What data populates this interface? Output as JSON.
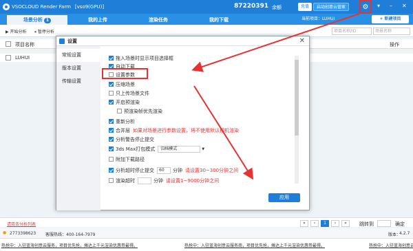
{
  "app": {
    "title": "VSOCLOUD Render Farm",
    "machine": "[vso9(GPU)]",
    "credits": "87220391",
    "balance": "余额",
    "recharge": "充值",
    "open_manager": "启动创意云管家",
    "gear_icon": "gear-icon",
    "minimize": "–",
    "close": "✕"
  },
  "nav": {
    "tabs": [
      {
        "label": "场景分析",
        "badge": "1"
      },
      {
        "label": "我的上传"
      },
      {
        "label": "渲染任务"
      },
      {
        "label": "我的下载"
      }
    ],
    "current_project_label": "当前项目：",
    "current_project": "LUHUI",
    "new_project": "+ 新建项目"
  },
  "toolbar": {
    "start": "▶ 开始分析",
    "pause": "⏸ 暂停分析",
    "project_search_placeholder": "项目名称/ID",
    "scene_search_placeholder": "场景名称"
  },
  "list": {
    "header_project": "项目名称",
    "header_ops": "操作",
    "rows": [
      "LUHUI"
    ]
  },
  "dialog": {
    "title": "设置",
    "close": "✕",
    "nav": [
      "常规设置",
      "版本设置",
      "传输设置"
    ],
    "options": [
      {
        "label": "拖入场景时显示项目选择框",
        "checked": true
      },
      {
        "label": "自动下载",
        "checked": true
      },
      {
        "label": "设置参数",
        "checked": false
      },
      {
        "label": "压缩场景",
        "checked": true
      },
      {
        "label": "只上传场景文件",
        "checked": false
      },
      {
        "label": "开启预渲染",
        "checked": true
      },
      {
        "label": "预渲染帧优先渲染",
        "checked": false
      },
      {
        "label": "重新分析",
        "checked": true
      },
      {
        "label": "合并层",
        "checked": true,
        "hint": "如果对场景进行参数设置，将不使用默认相机渲染"
      },
      {
        "label": "分析警告停止提交",
        "checked": true
      },
      {
        "label": "3ds Max打包模式",
        "checked": true,
        "select": "归档模式"
      },
      {
        "label": "附加下载路径",
        "checked": false
      },
      {
        "label": "分析超时停止提交",
        "checked": true,
        "value": "60",
        "unit": "分钟",
        "hint": "请设置30~300分钟之间"
      },
      {
        "label": "渲染超时",
        "checked": false,
        "unit": "分钟",
        "hint": "请设置1~9000分钟之间"
      }
    ],
    "apply": "应用"
  },
  "pagination": {
    "prev_first": "«",
    "prev": "‹",
    "page": "1",
    "next": "›",
    "next_last": "»",
    "jump_label": "跳转到",
    "confirm": "确定"
  },
  "footer": {
    "link": "请双击分析列表",
    "qq": "2773398623",
    "hotline": "客服热线：400-164-7979",
    "version_label": "版本：",
    "version": "4.2.7",
    "ticker_left": "热抢中：入驻蓝海创意云服务，项目优先抢，摊达上千元渲染优惠劵最得。",
    "ticker_mid": "热抢中：入驻蓝海创意云服务商，项目优先抢，摊达上千元渲染优惠劵最得。",
    "ticker_right": "热抢中：入驻蓝海创意云服务"
  }
}
